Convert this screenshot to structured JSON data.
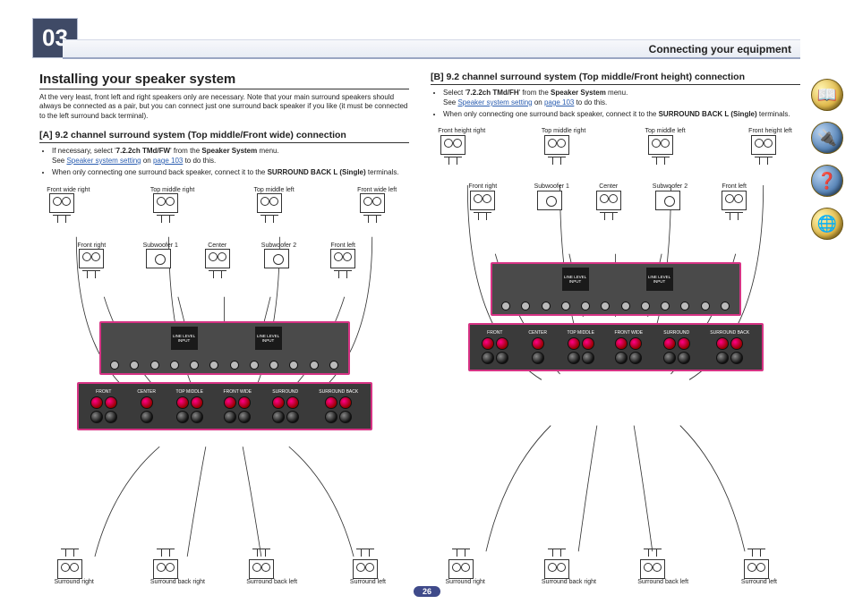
{
  "chapter_number": "03",
  "header": {
    "title": "Connecting your equipment"
  },
  "page_number": "26",
  "left": {
    "heading": "Installing your speaker system",
    "intro": "At the very least, front left and right speakers only are necessary. Note that your main surround speakers should always be connected as a pair, but you can connect just one surround back speaker if you like (it must be connected to the left surround back terminal).",
    "sub_heading": "[A] 9.2 channel surround system (Top middle/Front wide) connection",
    "notes": [
      {
        "pre": "If necessary, select '",
        "bold1": "7.2.2ch TMd/FW",
        "mid": "' from the ",
        "bold2": "Speaker System",
        "post": " menu."
      },
      {
        "pre": "See ",
        "link": "Speaker system setting",
        "mid": " on ",
        "link2": "page 103",
        "post": " to do this."
      },
      {
        "pre": "When only connecting one surround back speaker, connect it to the ",
        "bold1": "SURROUND BACK L (Single)",
        "post": " terminals."
      }
    ],
    "speakers_top": [
      {
        "label": "Front wide right"
      },
      {
        "label": "Top middle right"
      },
      {
        "label": "Top middle left"
      },
      {
        "label": "Front wide left"
      }
    ],
    "speakers_mid": [
      {
        "label": "Front right"
      },
      {
        "label": "Subwoofer 1"
      },
      {
        "label": "Center"
      },
      {
        "label": "Subwoofer 2"
      },
      {
        "label": "Front left"
      }
    ],
    "speakers_bot": [
      {
        "label": "Surround right"
      },
      {
        "label": "Surround back right"
      },
      {
        "label": "Surround back left"
      },
      {
        "label": "Surround left"
      }
    ],
    "terminal_groups": [
      "FRONT",
      "CENTER",
      "TOP MIDDLE",
      "FRONT WIDE",
      "SURROUND",
      "SURROUND BACK"
    ],
    "line_level_label": "LINE LEVEL INPUT"
  },
  "right": {
    "sub_heading": "[B] 9.2 channel surround system (Top middle/Front height) connection",
    "notes": [
      {
        "pre": "Select '",
        "bold1": "7.2.2ch TMd/FH",
        "mid": "' from the ",
        "bold2": "Speaker System",
        "post": " menu."
      },
      {
        "pre": "See ",
        "link": "Speaker system setting",
        "mid": " on ",
        "link2": "page 103",
        "post": " to do this."
      },
      {
        "pre": "When only connecting one surround back speaker, connect it to the ",
        "bold1": "SURROUND BACK L (Single)",
        "post": " terminals."
      }
    ],
    "speakers_top": [
      {
        "label": "Front height right"
      },
      {
        "label": "Top middle right"
      },
      {
        "label": "Top middle left"
      },
      {
        "label": "Front height left"
      }
    ],
    "speakers_mid": [
      {
        "label": "Front right"
      },
      {
        "label": "Subwoofer 1"
      },
      {
        "label": "Center"
      },
      {
        "label": "Subwoofer 2"
      },
      {
        "label": "Front left"
      }
    ],
    "speakers_bot": [
      {
        "label": "Surround right"
      },
      {
        "label": "Surround back right"
      },
      {
        "label": "Surround back left"
      },
      {
        "label": "Surround left"
      }
    ],
    "terminal_groups": [
      "FRONT",
      "CENTER",
      "TOP MIDDLE",
      "FRONT WIDE",
      "SURROUND",
      "SURROUND BACK"
    ],
    "line_level_label": "LINE LEVEL INPUT"
  },
  "side_buttons": [
    {
      "name": "manual-icon",
      "glyph": "📖"
    },
    {
      "name": "equipment-icon",
      "glyph": "🔌"
    },
    {
      "name": "help-icon",
      "glyph": "❓"
    },
    {
      "name": "network-icon",
      "glyph": "🌐"
    }
  ]
}
